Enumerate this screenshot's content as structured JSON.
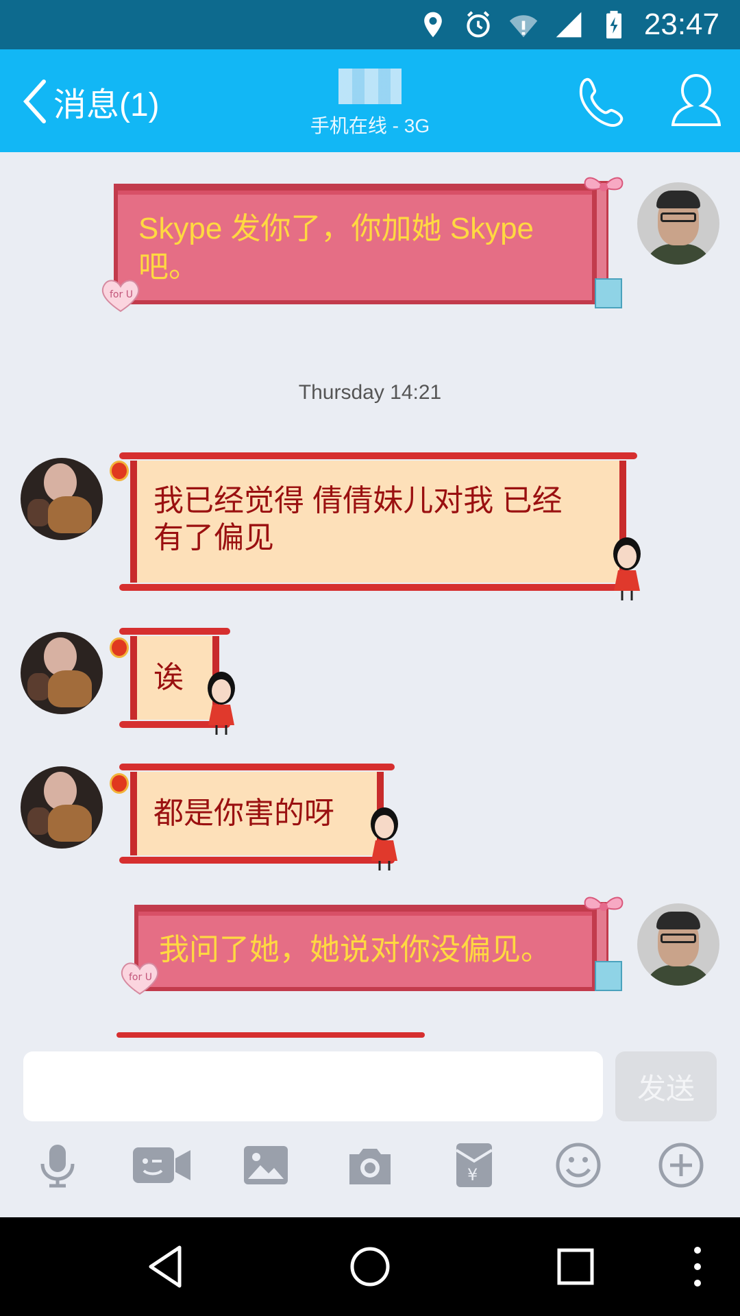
{
  "status_bar": {
    "time": "23:47",
    "icons": [
      "location-icon",
      "alarm-icon",
      "wifi-icon",
      "signal-icon",
      "battery-charging-icon"
    ]
  },
  "header": {
    "back_label": "消息(1)",
    "contact_name_blurred": true,
    "subtitle": "手机在线 - 3G",
    "actions": [
      "phone-icon",
      "profile-icon"
    ]
  },
  "messages": [
    {
      "side": "right",
      "style": "gift",
      "text": "Skype 发你了，你加她 Skype 吧。"
    },
    {
      "type": "timestamp",
      "text": "Thursday 14:21"
    },
    {
      "side": "left",
      "style": "scroll",
      "text": "我已经觉得 倩倩妹儿对我 已经有了偏见"
    },
    {
      "side": "left",
      "style": "scroll",
      "text": "诶"
    },
    {
      "side": "left",
      "style": "scroll",
      "text": "都是你害的呀"
    },
    {
      "side": "right",
      "style": "gift",
      "text": "我问了她，她说对你没偏见。"
    }
  ],
  "message_lines": {
    "m1_line1": "Skype 发你了，你加她 Skype",
    "m1_line2": "吧。",
    "m3_line1": "我已经觉得 倩倩妹儿对我 已经",
    "m3_line2": "有了偏见"
  },
  "input": {
    "placeholder": "",
    "value": "",
    "send_label": "发送"
  },
  "toolbar": [
    "microphone-icon",
    "video-call-icon",
    "image-icon",
    "camera-icon",
    "red-packet-icon",
    "emoji-icon",
    "more-plus-icon"
  ],
  "nav": [
    "back-nav-icon",
    "home-nav-icon",
    "recents-nav-icon",
    "overflow-menu-icon"
  ],
  "colors": {
    "header": "#12b7f5",
    "statusbar": "#0d6a8e",
    "gift_bubble": "#e56e85",
    "gift_text": "#ffd941",
    "scroll_bubble": "#fde0b9",
    "scroll_text": "#9a1010"
  }
}
